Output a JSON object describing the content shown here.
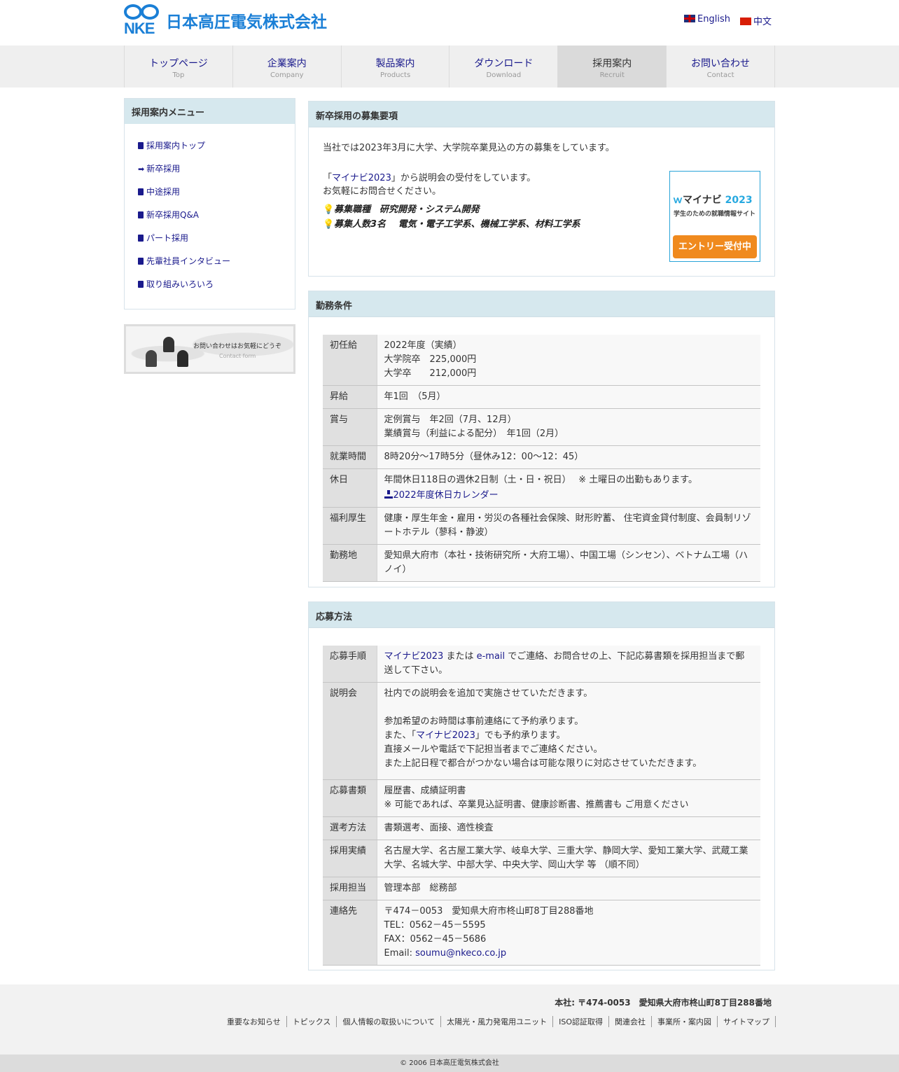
{
  "header": {
    "logo_mark": "NKE",
    "logo_text": "日本高圧電気株式会社",
    "lang_english": "English",
    "lang_chinese": "中文"
  },
  "nav": [
    {
      "jp": "トップページ",
      "en": "Top"
    },
    {
      "jp": "企業案内",
      "en": "Company"
    },
    {
      "jp": "製品案内",
      "en": "Products"
    },
    {
      "jp": "ダウンロード",
      "en": "Download"
    },
    {
      "jp": "採用案内",
      "en": "Recruit"
    },
    {
      "jp": "お問い合わせ",
      "en": "Contact"
    }
  ],
  "sidebar": {
    "title": "採用案内メニュー",
    "items": [
      "採用案内トップ",
      "新卒採用",
      "中途採用",
      "新卒採用Q&A",
      "パート採用",
      "先輩社員インタビュー",
      "取り組みいろいろ"
    ],
    "banner_text": "お問い合わせはお気軽にどうぞ",
    "banner_sub": "Contact form"
  },
  "recruit": {
    "title": "新卒採用の募集要項",
    "intro": "当社では2023年3月に大学、大学院卒業見込の方の募集をしています。",
    "line1_pre": "「",
    "line1_link": "マイナビ2023",
    "line1_post": "」から説明会の受付をしています。",
    "line2": "お気軽にお問合せください。",
    "job": "募集職種　研究開発・システム開発",
    "count": "募集人数3名　 電気・電子工学系、機械工学系、材料工学系",
    "banner": {
      "logo": "マイナビ",
      "year": "2023",
      "sub": "学生のための就職情報サイト",
      "button": "エントリー受付中"
    }
  },
  "conditions": {
    "title": "勤務条件",
    "rows": [
      {
        "th": "初任給",
        "lines": [
          "2022年度（実績）",
          "大学院卒　225,000円",
          "大学卒　　212,000円"
        ]
      },
      {
        "th": "昇給",
        "lines": [
          "年1回　（5月）"
        ]
      },
      {
        "th": "賞与",
        "lines": [
          "定例賞与　年2回（7月、12月）",
          "業績賞与（利益による配分）　年1回（2月）"
        ]
      },
      {
        "th": "就業時間",
        "lines": [
          "8時20分～17時5分（昼休み12：00～12：45）"
        ]
      },
      {
        "th": "休日",
        "lines": [
          "年間休日118日の週休2日制（土・日・祝日）　 ※ 土曜日の出勤もあります。"
        ],
        "link": "2022年度休日カレンダー"
      },
      {
        "th": "福利厚生",
        "lines": [
          "健康・厚生年金・雇用・労災の各種社会保険、財形貯蓄、 住宅資金貸付制度、会員制リゾートホテル（蓼科・静波）"
        ]
      },
      {
        "th": "勤務地",
        "lines": [
          "愛知県大府市（本社・技術研究所・大府工場）、中国工場（シンセン）、ベトナム工場（ハノイ）"
        ]
      }
    ]
  },
  "apply": {
    "title": "応募方法",
    "proc_th": "応募手順",
    "proc_link1": "マイナビ2023",
    "proc_mid": " または ",
    "proc_link2": "e-mail",
    "proc_rest": " でご連絡、お問合せの上、下記応募書類を採用担当まで郵送して下さい。",
    "session_th": "説明会",
    "session_l1": "社内での説明会を追加で実施させていただきます。",
    "session_l2": "参加希望のお時間は事前連絡にて予約承ります。",
    "session_l3_pre": "また、「",
    "session_l3_link": "マイナビ2023",
    "session_l3_post": "」でも予約承ります。",
    "session_l4": "直接メールや電話で下記担当者までご連絡ください。",
    "session_l5": "また上記日程で都合がつかない場合は可能な限りに対応させていただきます。",
    "rows": [
      {
        "th": "応募書類",
        "lines": [
          "履歴書、成績証明書",
          "※ 可能であれば、卒業見込証明書、健康診断書、推薦書も ご用意ください"
        ]
      },
      {
        "th": "選考方法",
        "lines": [
          "書類選考、面接、適性検査"
        ]
      },
      {
        "th": "採用実績",
        "lines": [
          "名古屋大学、名古屋工業大学、岐阜大学、三重大学、静岡大学、愛知工業大学、武蔵工業大学、名城大学、中部大学、中央大学、岡山大学 等 （順不同）"
        ]
      },
      {
        "th": "採用担当",
        "lines": [
          "管理本部　総務部"
        ]
      }
    ],
    "contact_th": "連絡先",
    "contact_l1": "〒474－0053　愛知県大府市柊山町8丁目288番地",
    "contact_l2": "TEL：0562－45－5595",
    "contact_l3": "FAX：0562－45－5686",
    "contact_email_label": "Email: ",
    "contact_email": "soumu@nkeco.co.jp"
  },
  "footer": {
    "address": "本社: 〒474-0053　愛知県大府市柊山町8丁目288番地",
    "links": [
      "重要なお知らせ",
      "トピックス",
      "個人情報の取扱いについて",
      "太陽光・風力発電用ユニット",
      "ISO認証取得",
      "関連会社",
      "事業所・案内図",
      "サイトマップ"
    ],
    "copyright": "© 2006 日本高圧電気株式会社"
  }
}
